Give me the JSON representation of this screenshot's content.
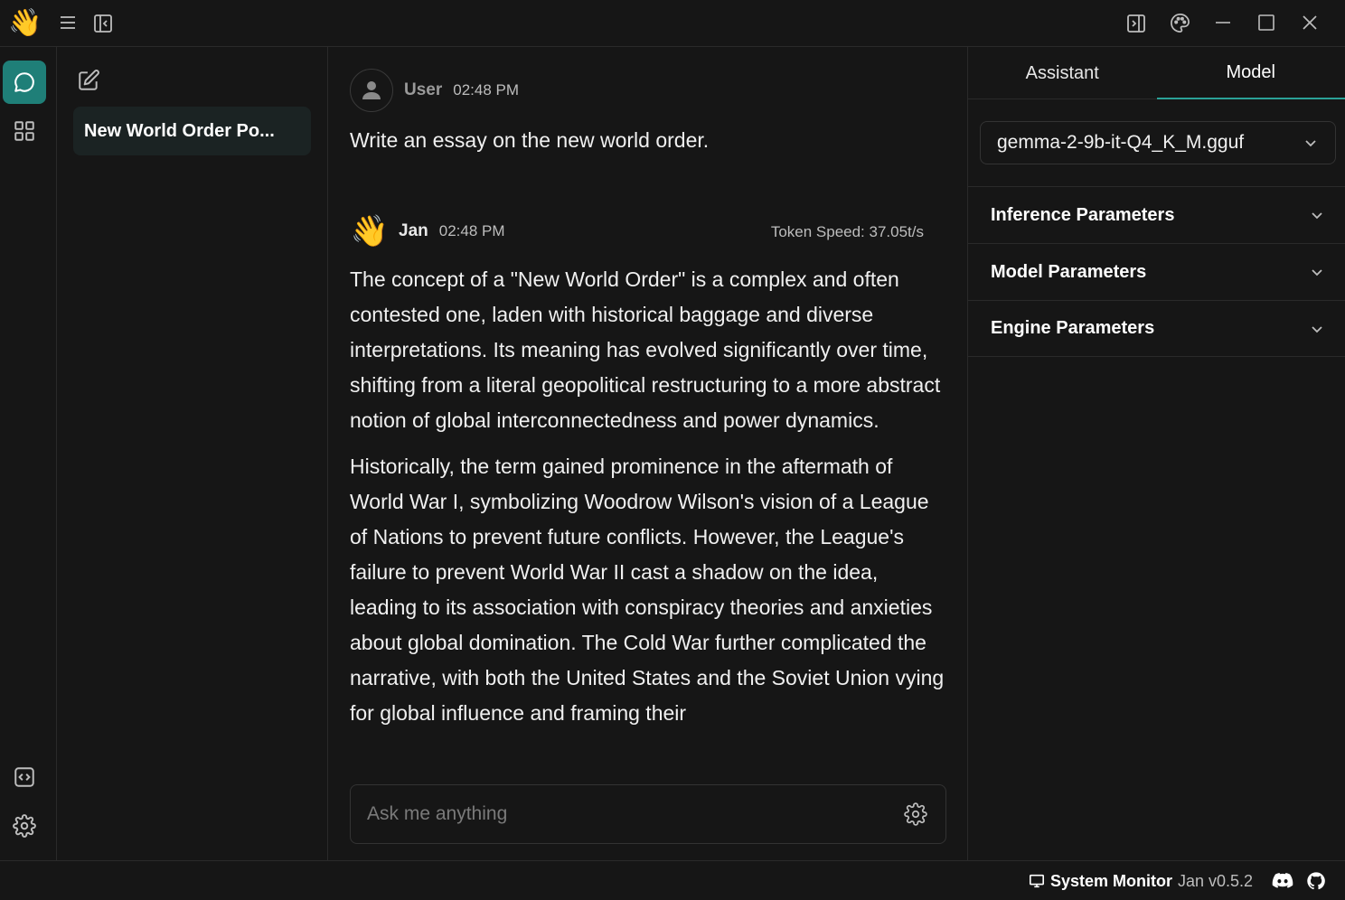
{
  "window": {
    "logo_emoji": "👋"
  },
  "threads": {
    "items": [
      {
        "title": "New World Order Po..."
      }
    ]
  },
  "chat": {
    "user": {
      "name": "User",
      "time": "02:48 PM",
      "text": "Write an essay on the new world order."
    },
    "assistant": {
      "avatar_emoji": "👋",
      "name": "Jan",
      "time": "02:48 PM",
      "token_speed": "Token Speed: 37.05t/s",
      "paragraphs": [
        "The concept of a \"New World Order\" is a complex and often contested one, laden with historical baggage and diverse interpretations. Its meaning has evolved significantly over time, shifting from a literal geopolitical restructuring to a more abstract notion of global interconnectedness and power dynamics.",
        "Historically, the term gained prominence in the aftermath of World War I, symbolizing Woodrow Wilson's vision of a League of Nations to prevent future conflicts. However, the League's failure to prevent World War II cast a shadow on the idea, leading to its association with conspiracy theories and anxieties about global domination. The Cold War further complicated the narrative, with both the United States and the Soviet Union vying for global influence and framing their"
      ]
    },
    "input": {
      "placeholder": "Ask me anything",
      "value": ""
    }
  },
  "right_panel": {
    "tabs": [
      {
        "label": "Assistant",
        "active": false
      },
      {
        "label": "Model",
        "active": true
      }
    ],
    "model_select": {
      "value": "gemma-2-9b-it-Q4_K_M.gguf"
    },
    "sections": [
      {
        "label": "Inference Parameters"
      },
      {
        "label": "Model Parameters"
      },
      {
        "label": "Engine Parameters"
      }
    ]
  },
  "status_bar": {
    "system_monitor": "System Monitor",
    "version": "Jan v0.5.2"
  },
  "colors": {
    "accent": "#1f7f78",
    "tab_underline": "#2aa198",
    "background": "#161616"
  }
}
